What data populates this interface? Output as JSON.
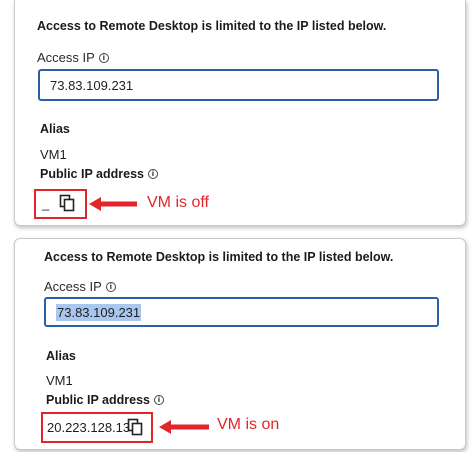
{
  "top_panel": {
    "heading": "Access to Remote Desktop is limited to the IP listed below.",
    "access_ip_label": "Access IP",
    "access_ip_value": "73.83.109.231",
    "alias_label": "Alias",
    "alias_value": "VM1",
    "public_ip_label": "Public IP address",
    "public_ip_value": "_",
    "callout": "VM is off"
  },
  "bottom_panel": {
    "heading": "Access to Remote Desktop is limited to the IP listed below.",
    "access_ip_label": "Access IP",
    "access_ip_value": "73.83.109.231",
    "alias_label": "Alias",
    "alias_value": "VM1",
    "public_ip_label": "Public IP address",
    "public_ip_value": "20.223.128.13",
    "callout": "VM is on"
  },
  "icons": {
    "info": "info-icon",
    "copy": "copy-icon",
    "arrow": "left-arrow-icon"
  },
  "colors": {
    "annotation_red": "#e0262b",
    "input_border": "#2d5fa8",
    "selection": "#a9c6ee"
  }
}
